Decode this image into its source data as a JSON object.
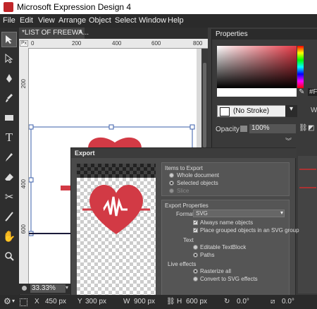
{
  "window": {
    "title": "Microsoft Expression Design 4"
  },
  "menu": [
    "File",
    "Edit",
    "View",
    "Arrange",
    "Object",
    "Select",
    "Window",
    "Help"
  ],
  "document": {
    "tab_title": "*LIST OF FREEWA...",
    "close_glyph": "×"
  },
  "ruler": {
    "h_ticks": [
      "0",
      "200",
      "400",
      "600",
      "800"
    ],
    "v_ticks": [
      "200",
      "400",
      "600"
    ],
    "origin": "Px"
  },
  "status": {
    "zoom": "33.33%"
  },
  "bottom_bar": {
    "x_label": "X",
    "x_value": "450 px",
    "y_label": "Y",
    "y_value": "300 px",
    "w_label": "W",
    "w_value": "900 px",
    "h_label": "H",
    "h_value": "600 px",
    "rotate_value": "0.0°",
    "skew_value": "0.0°"
  },
  "properties": {
    "title": "Properties",
    "stroke": "(No Stroke)",
    "opacity_label": "Opacity",
    "opacity_value": "100%",
    "fill_hex_partial": "#F"
  },
  "export_dialog": {
    "title": "Export",
    "items_section": "Items to Export",
    "items_options": [
      "Whole document",
      "Selected objects",
      "Slice"
    ],
    "items_selected": 1,
    "props_section": "Export Properties",
    "format_label": "Format",
    "format_value": "SVG",
    "check_always_name": "Always name objects",
    "check_grouped": "Place grouped objects in an SVG group",
    "text_label": "Text",
    "text_options": [
      "Editable TextBlock",
      "Paths"
    ],
    "text_selected": 1,
    "live_effects_label": "Live effects",
    "live_options": [
      "Rasterize all",
      "Convert to SVG effects"
    ],
    "live_selected": 0
  },
  "colors": {
    "heart_red": "#d23a45",
    "selection_blue": "#3a5ea8",
    "ui_dark": "#3c3c3c"
  },
  "icons": [
    "select-arrow-icon",
    "direct-select-icon",
    "pen-icon",
    "brush-icon",
    "rectangle-icon",
    "text-icon",
    "eyedropper-icon",
    "eraser-icon",
    "scissors-icon",
    "knife-icon",
    "hand-icon",
    "zoom-icon"
  ]
}
